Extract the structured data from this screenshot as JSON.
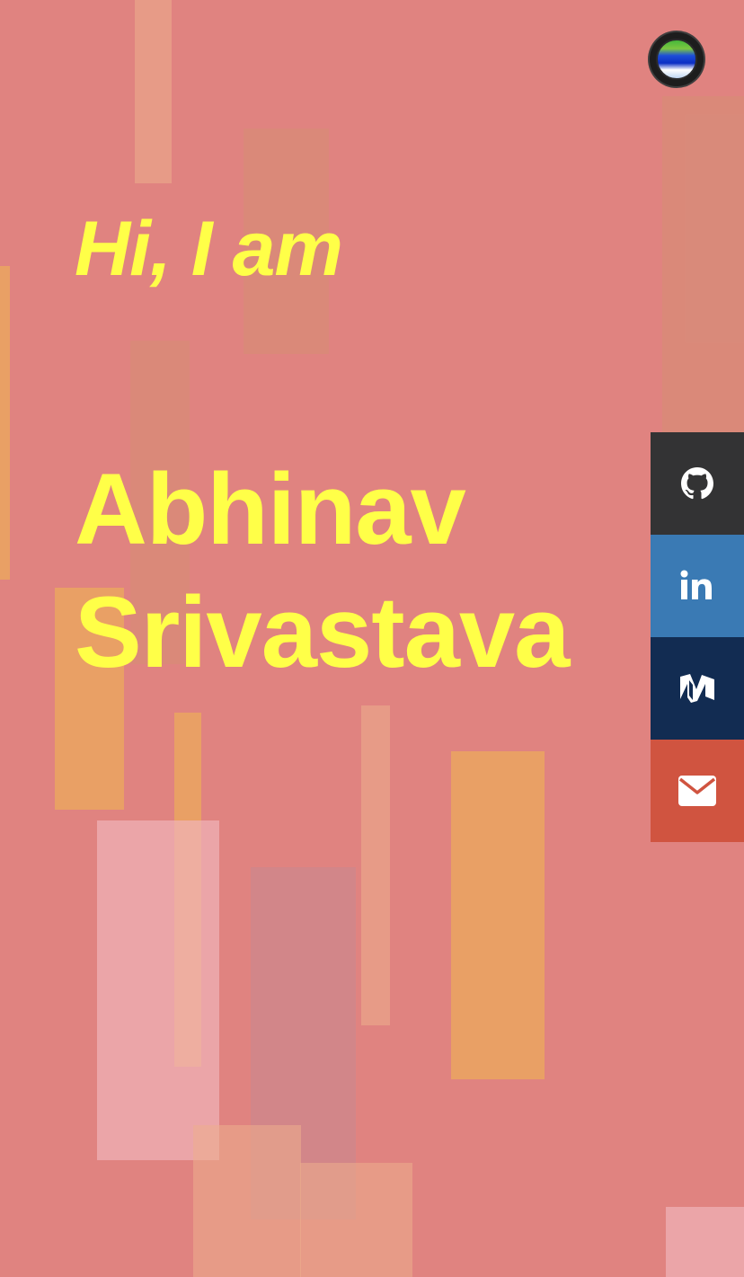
{
  "hero": {
    "greeting": "Hi, I am",
    "name_line1": "Abhinav",
    "name_line2": "Srivastava"
  },
  "theme_toggle": {
    "icon": "theme-orb-icon"
  },
  "social": [
    {
      "id": "github",
      "icon": "github-icon",
      "color": "#333334"
    },
    {
      "id": "linkedin",
      "icon": "linkedin-icon",
      "color": "#3a7ab4"
    },
    {
      "id": "medium",
      "icon": "medium-icon",
      "color": "#122c52"
    },
    {
      "id": "email",
      "icon": "email-icon",
      "color": "#d05440"
    }
  ],
  "colors": {
    "background": "#e08380",
    "text_accent": "#ffff48"
  }
}
